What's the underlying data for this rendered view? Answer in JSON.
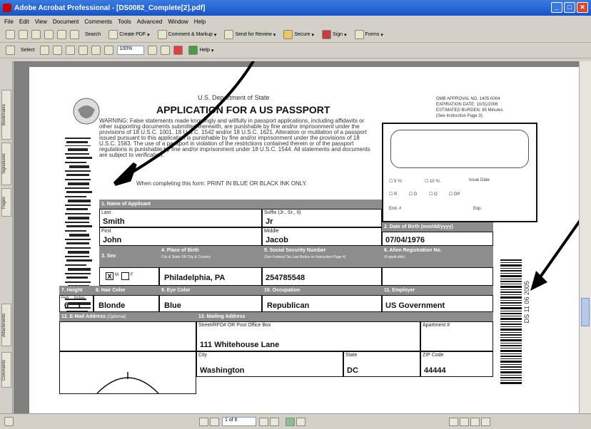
{
  "window": {
    "title": "Adobe Acrobat Professional - [DS0082_Complete[2].pdf]",
    "buttons": [
      "_",
      "□",
      "✕"
    ]
  },
  "menu": [
    "File",
    "Edit",
    "View",
    "Document",
    "Comments",
    "Tools",
    "Advanced",
    "Window",
    "Help"
  ],
  "toolbar1": {
    "search_label": "Search",
    "create_pdf_label": "Create PDF",
    "comment_markup_label": "Comment & Markup",
    "send_review_label": "Send for Review",
    "secure_label": "Secure",
    "sign_label": "Sign",
    "forms_label": "Forms"
  },
  "toolbar2": {
    "select_label": "Select",
    "zoom_value": "100%",
    "help_label": "Help"
  },
  "sidetabs": [
    "Bookmarks",
    "Signatures",
    "Pages",
    "Attachments",
    "Comments"
  ],
  "status": {
    "page_value": "1 of 6"
  },
  "form": {
    "agency": "U.S. Department of State",
    "title": "APPLICATION FOR A US PASSPORT",
    "omb": "OMB APPROVAL NO. 1405-0004",
    "expiration": "EXPIRATION DATE: 10/31/2006",
    "burden": "ESTIMATED BURDEN: 85 Minutes",
    "burden2": "(See Instruction Page 3)",
    "warning": "WARNING: False statements made knowingly and willfully in passport applications, including affidavits or other supporting documents submitted therewith, are punishable by fine and/or imprisonment under the provisions of 18 U.S.C. 1001, 18 U.S.C. 1542 and/or 18 U.S.C. 1621. Alteration or mutilation of a passport issued pursuant to this application is punishable by fine and/or imprisonment under the provisions of 18 U.S.C. 1583. The use of a passport in violation of the restrictions contained therein or of the passport regulations is punishable by fine and/or imprisonment under 18 U.S.C. 1544. All statements and documents are subject to verification.",
    "print_note": "When completing this form: PRINT IN BLUE OR BLACK INK ONLY.",
    "sec1": "1. Name of Applicant",
    "last_label": "Last",
    "last_value": "Smith",
    "suffix_label": "Suffix (Jr., Sr., II)",
    "suffix_value": "Jr",
    "first_label": "First",
    "first_value": "John",
    "middle_label": "Middle",
    "middle_value": "Jacob",
    "dob_label": "2. Date of Birth (mm/dd/yyyy)",
    "dob_value": "07/04/1976",
    "sex_label": "3. Sex",
    "sex_m": "M",
    "sex_f": "F",
    "birthplace_label": "4. Place of Birth",
    "birthplace_sub": "City & State OR City & Country",
    "birthplace_value": "Philadelphia, PA",
    "ssn_label": "5. Social Security Number",
    "ssn_sub": "(See Federal Tax Law Notice on Instruction Page 4)",
    "ssn_value": "254785548",
    "alien_label": "6. Alien Registration No.",
    "alien_sub": "(if applicable)",
    "height_label": "7. Height",
    "feet_label": "Feet",
    "inches_label": "Inches",
    "height_feet": "6",
    "height_inches": "1",
    "hair_label": "8. Hair Color",
    "hair_value": "Blonde",
    "eye_label": "9. Eye Color",
    "eye_value": "Blue",
    "occupation_label": "10. Occupation",
    "occupation_value": "Republican",
    "employer_label": "11. Employer",
    "employer_value": "US Government",
    "email_label": "12. E-Mail Address",
    "email_sub": "(Optional)",
    "mailing_label": "13. Mailing Address",
    "street_label": "Street/RFD# OR Post Office Box",
    "street_value": "111 Whitehouse Lane",
    "apt_label": "Apartment #",
    "city_label": "City",
    "city_value": "Washington",
    "state_label": "State",
    "state_value": "DC",
    "zip_label": "ZIP Code",
    "zip_value": "44444",
    "office_5yr": "5 Yr.",
    "office_10yr": "10 Yr.",
    "office_issue": "Issue Date",
    "office_r": "R",
    "office_d": "D",
    "office_o": "O",
    "office_dp": "DP",
    "office_end": "End. #",
    "office_exp": "Exp.",
    "barcode_text": "DS 11 06 2005"
  }
}
